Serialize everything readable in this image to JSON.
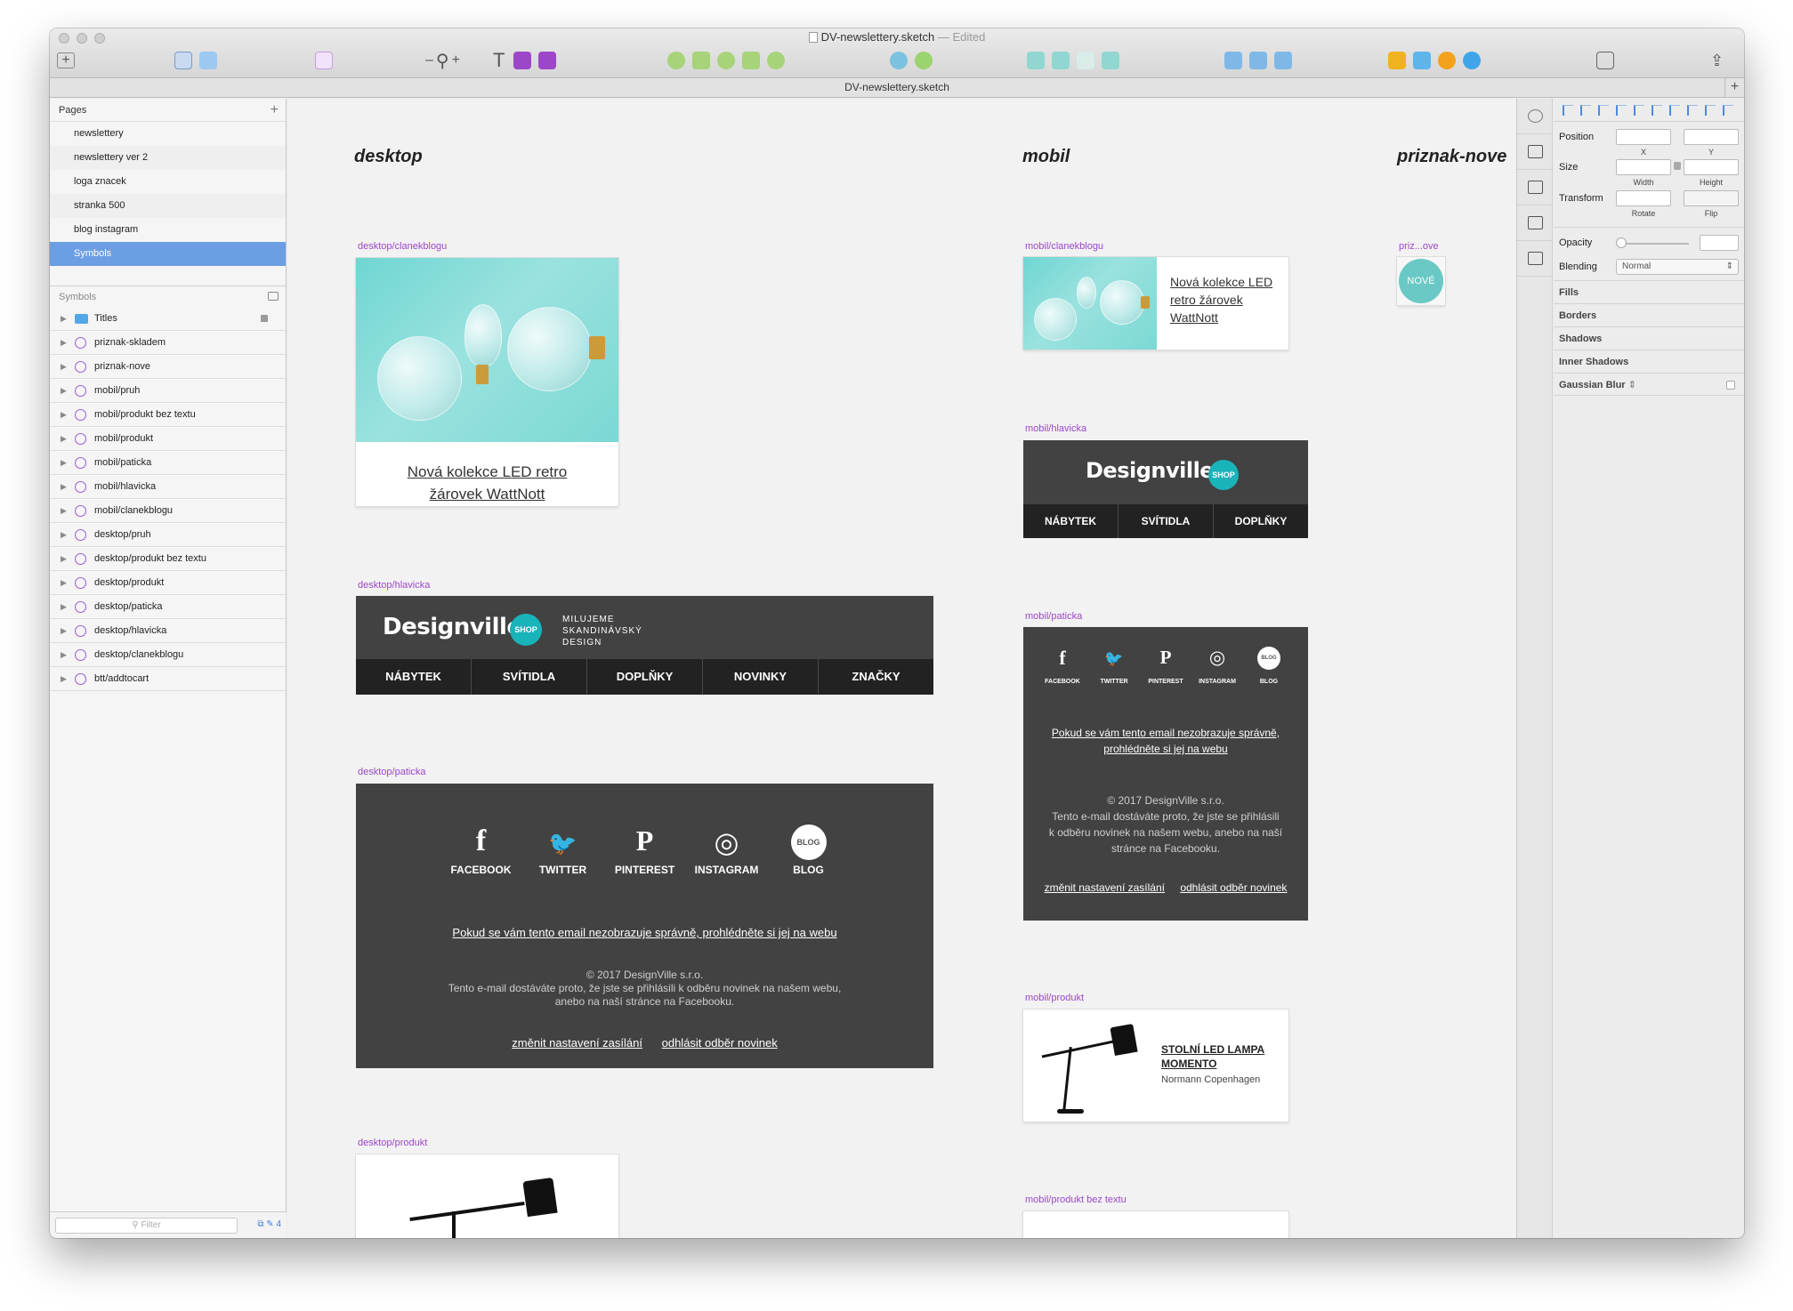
{
  "window": {
    "doc_title": "DV-newslettery.sketch",
    "edited_label": "— Edited",
    "tab_title": "DV-newslettery.sketch"
  },
  "pages_panel": {
    "header": "Pages",
    "add_icon": "plus-icon",
    "items": [
      "newslettery",
      "newslettery ver 2",
      "loga znacek",
      "stranka 500",
      "blog instagram",
      "Symbols"
    ],
    "selected": "Symbols"
  },
  "symbols_panel": {
    "header": "Symbols",
    "items": [
      "Titles",
      "priznak-skladem",
      "priznak-nove",
      "mobil/pruh",
      "mobil/produkt bez textu",
      "mobil/produkt",
      "mobil/paticka",
      "mobil/hlavicka",
      "mobil/clanekblogu",
      "desktop/pruh",
      "desktop/produkt bez textu",
      "desktop/produkt",
      "desktop/paticka",
      "desktop/hlavicka",
      "desktop/clanekblogu",
      "btt/addtocart"
    ]
  },
  "filter": {
    "placeholder": "Filter",
    "count": "4"
  },
  "canvas": {
    "titles": {
      "desktop": "desktop",
      "mobil": "mobil",
      "priznak": "priznak-nove"
    },
    "labels": {
      "d_clanek": "desktop/clanekblogu",
      "d_hlavicka": "desktop/hlavicka",
      "d_paticka": "desktop/paticka",
      "d_produkt": "desktop/produkt",
      "m_clanek": "mobil/clanekblogu",
      "m_hlavicka": "mobil/hlavicka",
      "m_paticka": "mobil/paticka",
      "m_produkt": "mobil/produkt",
      "m_produkt_bez": "mobil/produkt bez textu",
      "priz": "priz...ove"
    },
    "article_title": "Nová kolekce LED retro žárovek WattNott",
    "logo_text": "Designville",
    "logo_badge": "SHOP",
    "tagline": [
      "MILUJEME",
      "SKANDINÁVSKÝ",
      "DESIGN"
    ],
    "desktop_nav": [
      "NÁBYTEK",
      "SVÍTIDLA",
      "DOPLŇKY",
      "NOVINKY",
      "ZNAČKY"
    ],
    "mobile_nav": [
      "NÁBYTEK",
      "SVÍTIDLA",
      "DOPLŇKY"
    ],
    "social": [
      {
        "label": "FACEBOOK",
        "glyph": "f",
        "icon": "facebook-icon"
      },
      {
        "label": "TWITTER",
        "glyph": "🐦",
        "icon": "twitter-icon"
      },
      {
        "label": "PINTEREST",
        "glyph": "P",
        "icon": "pinterest-icon"
      },
      {
        "label": "INSTAGRAM",
        "glyph": "◎",
        "icon": "instagram-icon"
      },
      {
        "label": "BLOG",
        "glyph": "BLOG",
        "icon": "blog-icon"
      }
    ],
    "footer_link_desktop": "Pokud se vám tento email nezobrazuje správně, prohlédněte si jej na webu",
    "footer_link_mobile_1": "Pokud se vám tento email nezobrazuje správně,",
    "footer_link_mobile_2": "prohlédněte si jej na webu",
    "copyright": "© 2017 DesignVille s.r.o.",
    "footer_text_desktop_1": "Tento e-mail dostáváte proto, že jste se přihlásili k odběru novinek na našem webu,",
    "footer_text_desktop_2": "anebo na naší stránce na Facebooku.",
    "footer_text_mobile": [
      "Tento e-mail dostáváte proto, že jste se přihlásili",
      "k odběru novinek na našem webu, anebo na naší",
      "stránce na Facebooku."
    ],
    "settings_link": "změnit nastavení zasílání",
    "unsubscribe_link": "odhlásit odběr novinek",
    "product_name": "STOLNÍ LED LAMPA MOMENTO",
    "product_brand": "Normann Copenhagen",
    "badge_new": "NOVÉ"
  },
  "inspector": {
    "position": "Position",
    "x": "X",
    "y": "Y",
    "size": "Size",
    "width": "Width",
    "height": "Height",
    "transform": "Transform",
    "rotate": "Rotate",
    "flip": "Flip",
    "opacity": "Opacity",
    "blending": "Blending",
    "blending_value": "Normal",
    "fills": "Fills",
    "borders": "Borders",
    "shadows": "Shadows",
    "inner_shadows": "Inner Shadows",
    "gaussian_blur": "Gaussian Blur"
  },
  "colors": {
    "accent": "#6c9ee4",
    "symbol_label": "#9c47c8",
    "teal": "#19b3ba",
    "dark": "#424242"
  }
}
